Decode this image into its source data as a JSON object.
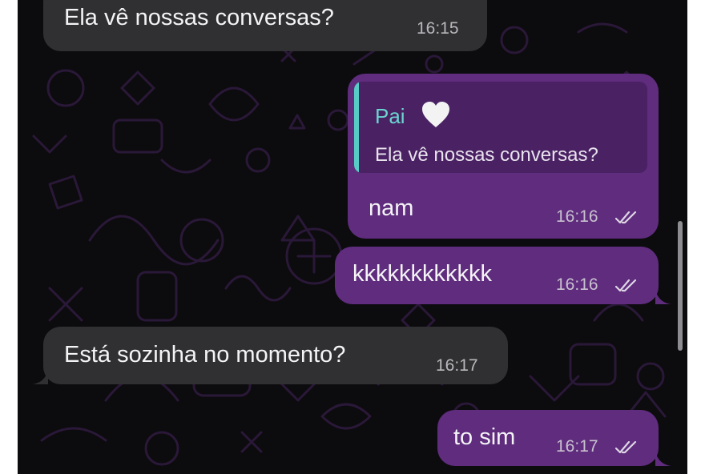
{
  "messages": [
    {
      "id": "m1",
      "direction": "incoming",
      "text": "Ela vê nossas conversas?",
      "time": "16:15"
    },
    {
      "id": "m2",
      "direction": "outgoing",
      "text": "nam",
      "time": "16:16",
      "status": "read",
      "reply_to": {
        "sender": "Pai",
        "sender_emoji": "🤍",
        "text": "Ela vê nossas conversas?"
      }
    },
    {
      "id": "m3",
      "direction": "outgoing",
      "text": "kkkkkkkkkkkk",
      "time": "16:16",
      "status": "read"
    },
    {
      "id": "m4",
      "direction": "incoming",
      "text": "Está sozinha no momento?",
      "time": "16:17"
    },
    {
      "id": "m5",
      "direction": "outgoing",
      "text": "to sim",
      "time": "16:17",
      "status": "read"
    }
  ],
  "colors": {
    "chat_background": "#0c0b0e",
    "incoming_bubble": "#303033",
    "outgoing_bubble": "#5f2c7e",
    "quote_accent": "#58cbc6"
  },
  "icons": {
    "read_receipt": "double-check-icon",
    "heart": "white-heart-icon"
  }
}
